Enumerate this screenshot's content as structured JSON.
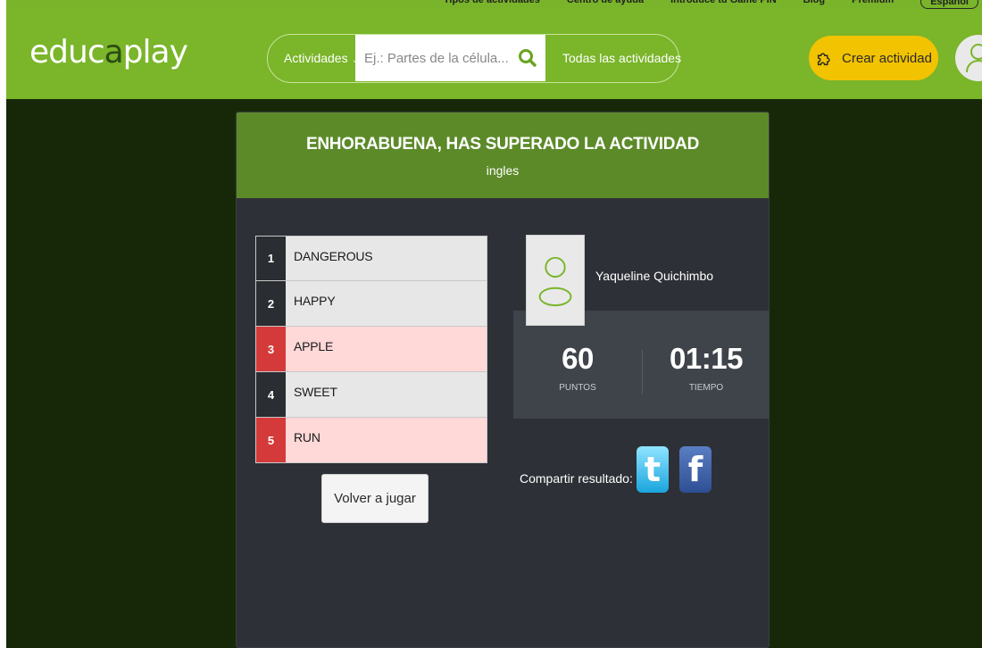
{
  "top_links": {
    "items": [
      "Tipos de actividades",
      "Centro de ayuda",
      "Introduce tu Game PIN",
      "Blog",
      "Premium"
    ],
    "language": "Español"
  },
  "header": {
    "logo_primary": "educ",
    "logo_accent": "a",
    "logo_rest": "play",
    "search_category": "Actividades",
    "search_placeholder": "Ej.: Partes de la célula...",
    "all_activities": "Todas las actividades",
    "create_button": "Crear actividad"
  },
  "result": {
    "title": "ENHORABUENA, HAS SUPERADO LA ACTIVIDAD",
    "activity": "ingles",
    "words": [
      {
        "num": "1",
        "text": "DANGEROUS",
        "status": "correct"
      },
      {
        "num": "2",
        "text": "HAPPY",
        "status": "correct"
      },
      {
        "num": "3",
        "text": "APPLE",
        "status": "wrong"
      },
      {
        "num": "4",
        "text": "SWEET",
        "status": "correct"
      },
      {
        "num": "5",
        "text": "RUN",
        "status": "wrong"
      }
    ],
    "replay_button": "Volver a jugar",
    "player_name": "Yaqueline Quichimbo",
    "points_value": "60",
    "points_label": "PUNTOS",
    "time_value": "01:15",
    "time_label": "TIEMPO",
    "share_label": "Compartir resultado:"
  },
  "colors": {
    "brand_green": "#7ab52a",
    "header_green": "#5c8a29",
    "create_yellow": "#f2c300",
    "wrong_red": "#d43a3a"
  },
  "icons": [
    "search-icon",
    "puzzle-icon",
    "user-avatar-icon",
    "twitter-icon",
    "facebook-icon",
    "chevron-down-icon"
  ]
}
